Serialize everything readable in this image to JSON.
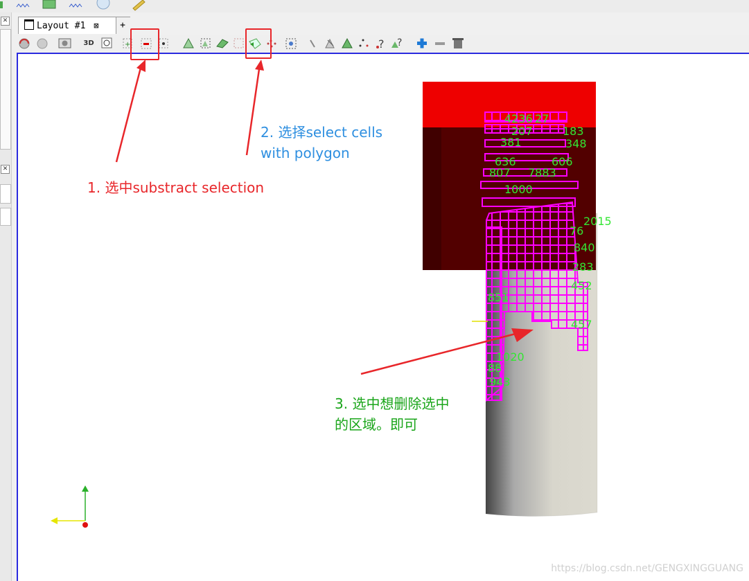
{
  "tabs": [
    {
      "label": "Layout #1",
      "close": "⊠"
    },
    {
      "label": "+"
    }
  ],
  "toolbar": {
    "three_d": "3D"
  },
  "annotations": {
    "step1": "1. 选中substract selection",
    "step2_line1": "2. 选择select cells",
    "step2_line2": "with polygon",
    "step3_line1": "3. 选中想删除选中",
    "step3_line2": "的区域。即可"
  },
  "cell_ids": [
    "4236",
    "27",
    "207",
    "183",
    "381",
    "348",
    "636",
    "606",
    "807",
    "7883",
    "1000",
    "2015",
    "76",
    "840",
    "283",
    "452",
    "457",
    "851",
    "1020",
    "943",
    "88"
  ],
  "watermark": "https://blog.csdn.net/GENGXINGGUANG",
  "colors": {
    "annotation_red": "#e8262a",
    "annotation_blue": "#2e8fe0",
    "annotation_green": "#1aa51a",
    "selection_magenta": "#ff00ff",
    "label_green": "#33e633",
    "block_red": "#ee0000",
    "block_dark": "#520000"
  }
}
